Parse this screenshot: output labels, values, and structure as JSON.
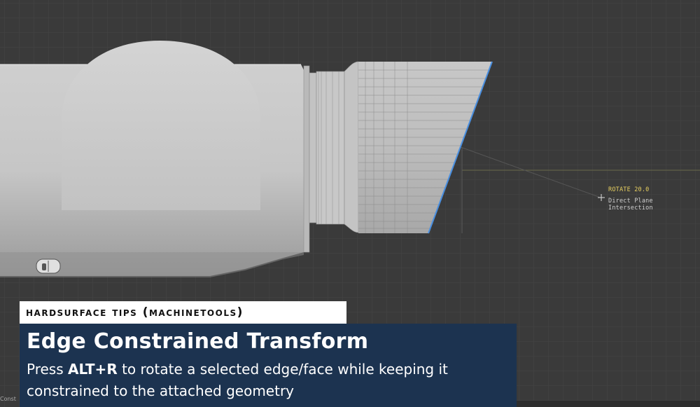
{
  "viewport": {
    "background": "#3a3a3a",
    "grid_color": "#444444",
    "hud": {
      "operation": "ROTATE 20.0",
      "mode": "Direct Plane Intersection",
      "operation_color": "#e8d060"
    },
    "selected_edge_color": "#4a8fe0"
  },
  "caption": {
    "series_tag": "Hardsurface Tips (MACHINEtools)",
    "title": "Edge Constrained Transform",
    "body_pre": "Press ",
    "body_key": "ALT+R",
    "body_post": " to rotate a selected edge/face while keeping it constrained to the attached geometry",
    "panel_color": "#1c3350"
  },
  "status_bar": {
    "text": "Const"
  }
}
